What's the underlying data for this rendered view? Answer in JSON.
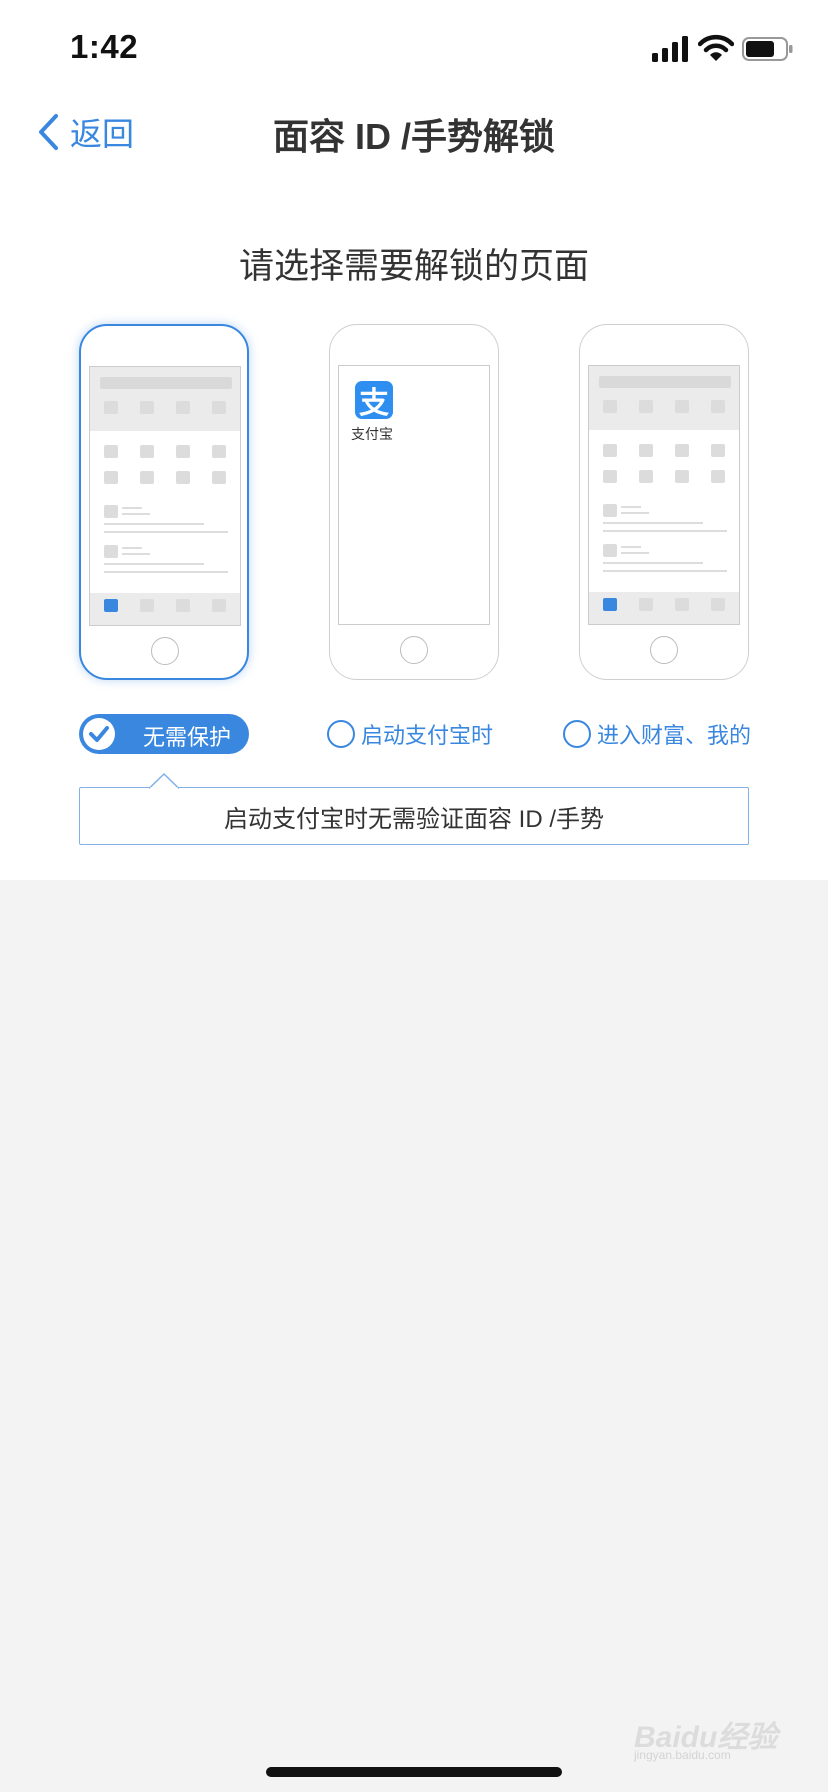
{
  "status_bar": {
    "time": "1:42"
  },
  "nav": {
    "back_label": "返回",
    "title": "面容 ID /手势解锁"
  },
  "heading": "请选择需要解锁的页面",
  "phone_preview": {
    "app_name": "支付宝",
    "logo_glyph": "支"
  },
  "options": [
    {
      "label": "无需保护",
      "selected": true
    },
    {
      "label": "启动支付宝时",
      "selected": false
    },
    {
      "label": "进入财富、我的",
      "selected": false
    }
  ],
  "description": "启动支付宝时无需验证面容 ID /手势",
  "watermark": {
    "text": "Baidu经验",
    "url_text": "jingyan.baidu.com"
  },
  "colors": {
    "accent": "#3a87e0",
    "background": "#f3f3f3"
  }
}
